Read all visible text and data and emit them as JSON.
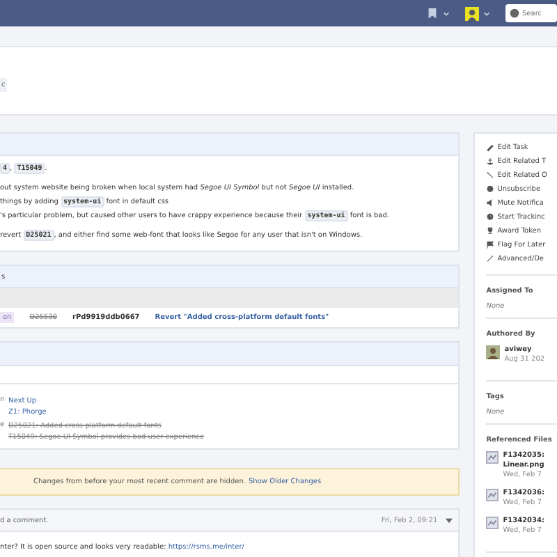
{
  "topbar": {
    "search": {
      "placeholder": "Searc"
    }
  },
  "header": {
    "tag": "c"
  },
  "summary": {
    "paragraphs": [
      [
        {
          "kind": "code",
          "text": "4"
        },
        {
          "kind": "text",
          "text": ", "
        },
        {
          "kind": "code",
          "text": "T15049"
        },
        {
          "kind": "text",
          "text": "."
        }
      ],
      [
        {
          "kind": "text",
          "text": "out system website being broken when local system had *Segoe UI Symbol* but not *Segoe UI* installed."
        }
      ],
      [
        {
          "kind": "text",
          "text": "things by adding "
        },
        {
          "kind": "code",
          "text": "system-ui"
        },
        {
          "kind": "text",
          "text": " font in default css"
        }
      ],
      [
        {
          "kind": "text",
          "text": "'s particular problem, but caused other users to have crappy experience because their "
        },
        {
          "kind": "code",
          "text": "system-ui"
        },
        {
          "kind": "text",
          "text": " font is bad."
        }
      ],
      [
        {
          "kind": "text",
          "text": "revert "
        },
        {
          "kind": "code",
          "text": "D25021"
        },
        {
          "kind": "text",
          "text": ", and either find some web-font that looks like Segoe for any user that isn't on Windows."
        }
      ]
    ]
  },
  "commits": {
    "title": "s",
    "row": {
      "status": "on",
      "revision": "D25530",
      "hash": "rPd9919ddb0667",
      "message": "Revert \"Added cross-platform default fonts\""
    }
  },
  "relations": {
    "rows": [
      {
        "label": "n",
        "links": [
          {
            "text": "Next Up",
            "closed": false
          },
          {
            "text": "Z1: Phorge",
            "closed": false
          }
        ]
      },
      {
        "label": "e",
        "links": [
          {
            "text": "D25021: Added cross-platform default fonts",
            "closed": true
          },
          {
            "text": "T15049: Segoe UI Symbol provides bad user experience",
            "closed": true
          }
        ]
      }
    ]
  },
  "notice": {
    "text": "Changes from before your most recent comment are hidden.",
    "link": "Show Older Changes"
  },
  "comment": {
    "header": "d a comment.",
    "time": "Fri, Feb 2, 09:21",
    "body": "nter? It is open source and looks very readable: ",
    "link": "https://rsms.me/inter/"
  },
  "sidebar": {
    "actions": [
      "Edit Task",
      "Edit Related T",
      "Edit Related O",
      "Unsubscribe",
      "Mute Notifica",
      "Start Trackinc",
      "Award Token",
      "Flag For Later",
      "Advanced/De"
    ],
    "assigned": {
      "title": "Assigned To",
      "value": "None"
    },
    "author": {
      "title": "Authored By",
      "name": "aviwey",
      "date": "Aug 31 202"
    },
    "tags": {
      "title": "Tags",
      "value": "None"
    },
    "files": {
      "title": "Referenced Files",
      "items": [
        {
          "name": "F1342035: Linear.png",
          "date": "Wed, Feb 7"
        },
        {
          "name": "F1342036:",
          "date": "Wed, Feb 7"
        },
        {
          "name": "F1342034:",
          "date": "Wed, Feb 7"
        }
      ]
    }
  }
}
